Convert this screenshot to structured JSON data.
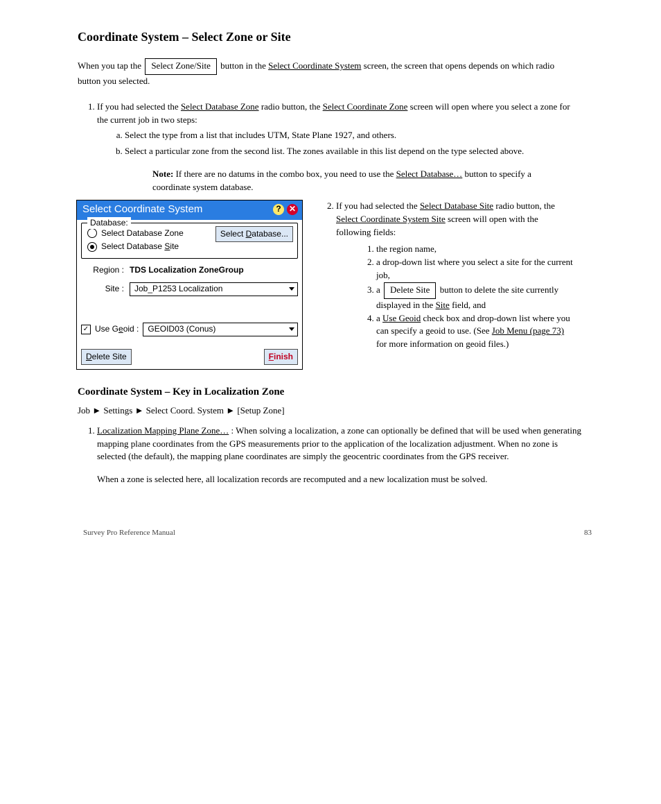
{
  "title": "Coordinate System – Select Zone or Site",
  "subtitle_parts": {
    "pre": "When you tap the ",
    "box": "Select Zone/Site",
    "mid": " button in the ",
    "ul1": "Select Coordinate System",
    "post": " screen, the screen that opens depends on which radio button you selected."
  },
  "step1": {
    "pre": "If you had selected the ",
    "ul": "Select Database Zone",
    "mid": " radio button, the ",
    "ul2": "Select Coordinate Zone",
    "post": " screen will open where you select a zone for the current job in two steps:"
  },
  "step1a": "Select the type from a list that includes UTM, State Plane 1927, and others.",
  "step1b": "Select a particular zone from the second list. The zones available in this list depend on the type selected above.",
  "note": {
    "lead": "Note:",
    "body": " If there are no datums in the combo box, you need to use the ",
    "ul": "Select Database…",
    "post": " button to specify a coordinate system database."
  },
  "step2": {
    "pre": "If you had selected the ",
    "ul": "Select Database Site",
    "mid": " radio button, the ",
    "ul2": "Select Coordinate System Site",
    "post": " screen will open with the following fields:"
  },
  "step2_1": "the region name,",
  "step2_2": {
    "pre": "a drop-down list where you select a site for the current job,",
    "post": ""
  },
  "step2_3": {
    "pre": "a ",
    "box": "Delete Site",
    "mid": " button to delete the site currently displayed in the ",
    "ul": "Site",
    "post": " field, and"
  },
  "step2_4": {
    "pre": "a ",
    "ul": "Use Geoid",
    "mid": " check box and drop-down list where you can specify a geoid to use. (See ",
    "ul2": "Job Menu (page 73)",
    "post": " for more information on geoid files.)"
  },
  "dialog": {
    "title": "Select Coordinate System",
    "db_legend": "Database:",
    "radio_zone": "Select Database Zone",
    "radio_site": "Select Database Site",
    "select_db_btn": "Select Database...",
    "region_label": "Region :",
    "region_value": "TDS Localization ZoneGroup",
    "site_label": "Site :",
    "site_value": "Job_P1253 Localization",
    "use_geoid_label": "Use Geoid :",
    "geoid_value": "GEOID03 (Conus)",
    "delete_site_btn": "Delete Site",
    "finish_btn": "Finish"
  },
  "sec_title": "Coordinate System – Key in Localization Zone",
  "sec_sub": "Job ► Settings ► Select Coord. System ► [Setup Zone]",
  "sec_step1": {
    "pre": "",
    "ul": "Localization Mapping Plane Zone…",
    "post": ": When solving a localization, a zone can optionally be defined that will be used when generating mapping plane coordinates from the GPS measurements prior to the application of the localization adjustment. When no zone is selected (the default), the mapping plane coordinates are simply the geocentric coordinates from the GPS receiver."
  },
  "sec_para": "When a zone is selected here, all localization records are recomputed and a new localization must be solved.",
  "footer_left": "Survey Pro Reference Manual",
  "footer_right": "83"
}
